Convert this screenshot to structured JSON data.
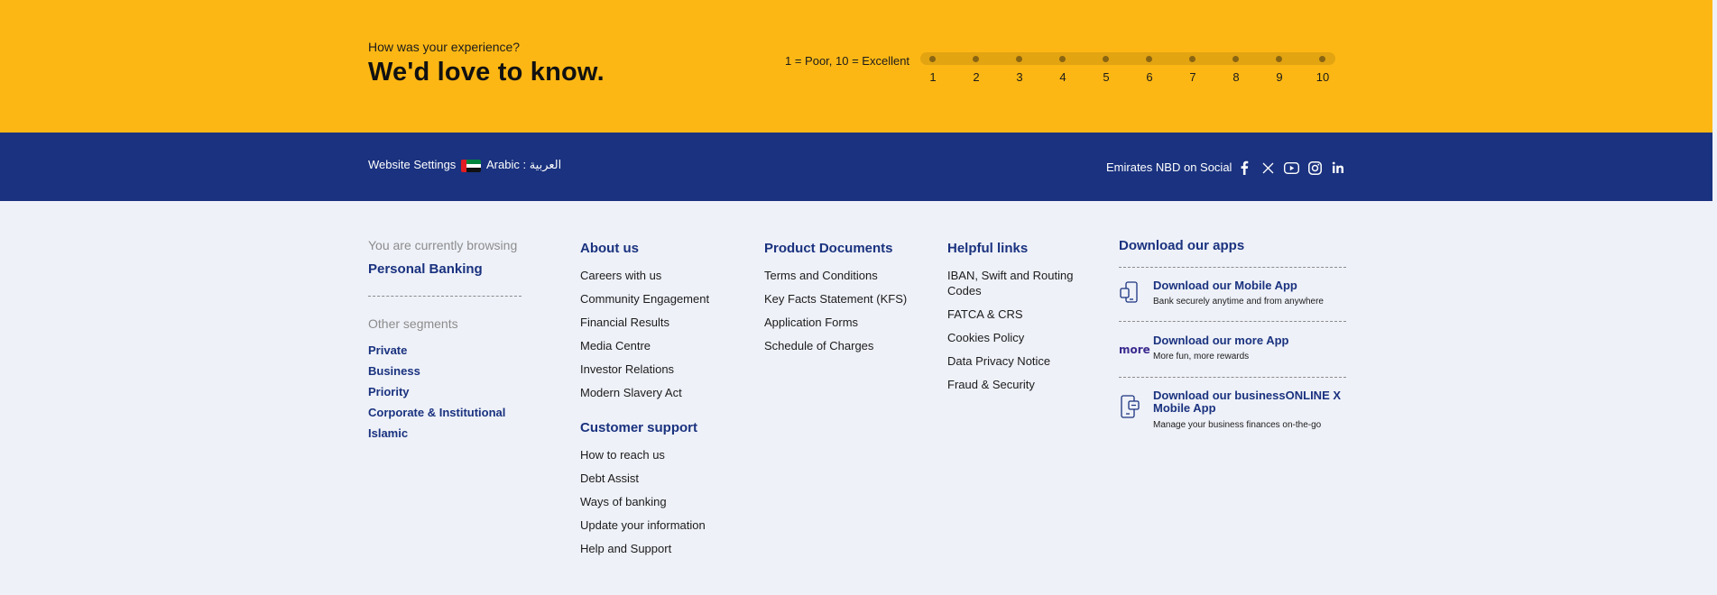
{
  "feedback": {
    "question": "How was your experience?",
    "title": "We'd love to know.",
    "scale_label": "1 = Poor, 10 = Excellent",
    "ratings": [
      "1",
      "2",
      "3",
      "4",
      "5",
      "6",
      "7",
      "8",
      "9",
      "10"
    ]
  },
  "settings_bar": {
    "website_settings": "Website Settings",
    "language": "Arabic : العربية",
    "social_label": "Emirates NBD on Social",
    "social_icons": [
      "facebook-icon",
      "x-icon",
      "youtube-icon",
      "instagram-icon",
      "linkedin-icon"
    ]
  },
  "browsing": {
    "label": "You are currently browsing",
    "current": "Personal Banking",
    "other_label": "Other segments",
    "segments": [
      "Private",
      "Business",
      "Priority",
      "Corporate & Institutional",
      "Islamic"
    ]
  },
  "about": {
    "title": "About us",
    "links": [
      "Careers with us",
      "Community Engagement",
      "Financial Results",
      "Media Centre",
      "Investor Relations",
      "Modern Slavery Act"
    ]
  },
  "support": {
    "title": "Customer support",
    "links": [
      "How to reach us",
      "Debt Assist",
      "Ways of banking",
      "Update your information",
      "Help and Support"
    ]
  },
  "documents": {
    "title": "Product Documents",
    "links": [
      "Terms and Conditions",
      "Key Facts Statement (KFS)",
      "Application Forms",
      "Schedule of Charges"
    ]
  },
  "helpful": {
    "title": "Helpful links",
    "links": [
      "IBAN, Swift and Routing",
      "Codes",
      "FATCA & CRS",
      "Cookies Policy",
      "Data Privacy Notice",
      "Fraud & Security"
    ]
  },
  "apps": {
    "title": "Download our apps",
    "items": [
      {
        "title": "Download our Mobile App",
        "desc": "Bank securely anytime and from anywhere",
        "icon": "mobile-phone-icon"
      },
      {
        "title": "Download our more App",
        "desc": "More fun, more rewards",
        "icon": "more-app-logo",
        "logo_text": "more"
      },
      {
        "title": "Download our businessONLINE X",
        "title2": "Mobile App",
        "desc": "Manage your business finances on-the-go",
        "icon": "business-phone-icon"
      }
    ]
  },
  "colors": {
    "feedback_bg": "#fdb714",
    "bar_bg": "#1a327f",
    "footer_bg": "#eef1f8",
    "link_blue": "#1a327f"
  }
}
